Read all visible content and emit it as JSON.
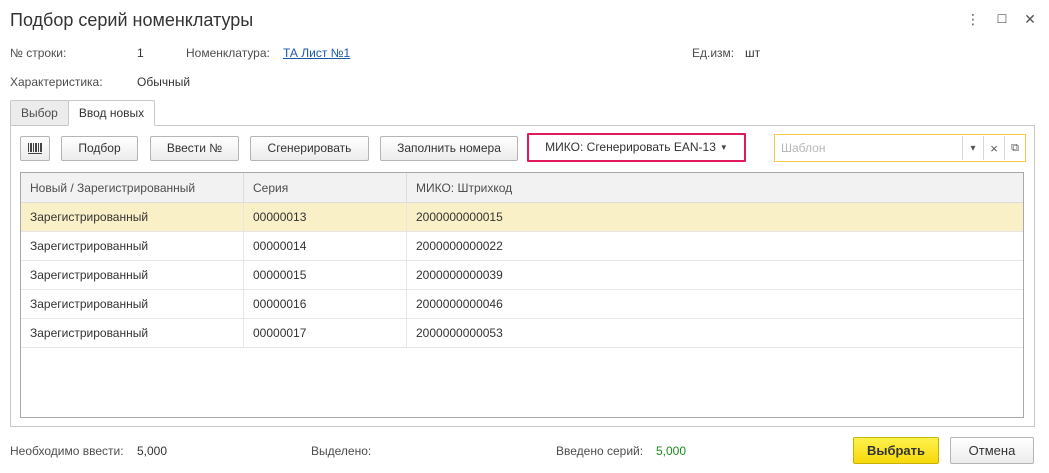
{
  "window": {
    "title": "Подбор серий номенклатуры",
    "menu_icon": "⋮",
    "maximize_icon": "☐",
    "close_icon": "✕"
  },
  "info": {
    "row_label": "№ строки:",
    "row_value": "1",
    "nomenclature_label": "Номенклатура:",
    "nomenclature_value": "ТА Лист №1",
    "unit_label": "Ед.изм:",
    "unit_value": "шт",
    "characteristic_label": "Характеристика:",
    "characteristic_value": "Обычный"
  },
  "tabs": [
    {
      "label": "Выбор",
      "active": false
    },
    {
      "label": "Ввод новых",
      "active": true
    }
  ],
  "toolbar": {
    "barcode_icon": "barcode-icon",
    "podbor_label": "Подбор",
    "enter_number_label": "Ввести №",
    "generate_label": "Сгенерировать",
    "fill_numbers_label": "Заполнить номера",
    "miko_generate_label": "МИКО: Сгенерировать EAN-13",
    "miko_accent_color": "#e0195c",
    "template_placeholder": "Шаблон",
    "dropdown_icon": "▾",
    "clear_icon": "×",
    "open_icon": "⧉"
  },
  "table": {
    "columns": [
      "Новый / Зарегистрированный",
      "Серия",
      "МИКО: Штрихкод"
    ],
    "rows": [
      {
        "status": "Зарегистрированный",
        "series": "00000013",
        "barcode": "2000000000015"
      },
      {
        "status": "Зарегистрированный",
        "series": "00000014",
        "barcode": "2000000000022"
      },
      {
        "status": "Зарегистрированный",
        "series": "00000015",
        "barcode": "2000000000039"
      },
      {
        "status": "Зарегистрированный",
        "series": "00000016",
        "barcode": "2000000000046"
      },
      {
        "status": "Зарегистрированный",
        "series": "00000017",
        "barcode": "2000000000053"
      }
    ],
    "selected_row": 0,
    "selected_color": "#faf0c8"
  },
  "footer": {
    "required_label": "Необходимо ввести:",
    "required_value": "5,000",
    "selected_label": "Выделено:",
    "entered_label": "Введено серий:",
    "entered_value": "5,000",
    "select_button": "Выбрать",
    "cancel_button": "Отмена",
    "primary_color": "#f5d90a"
  }
}
